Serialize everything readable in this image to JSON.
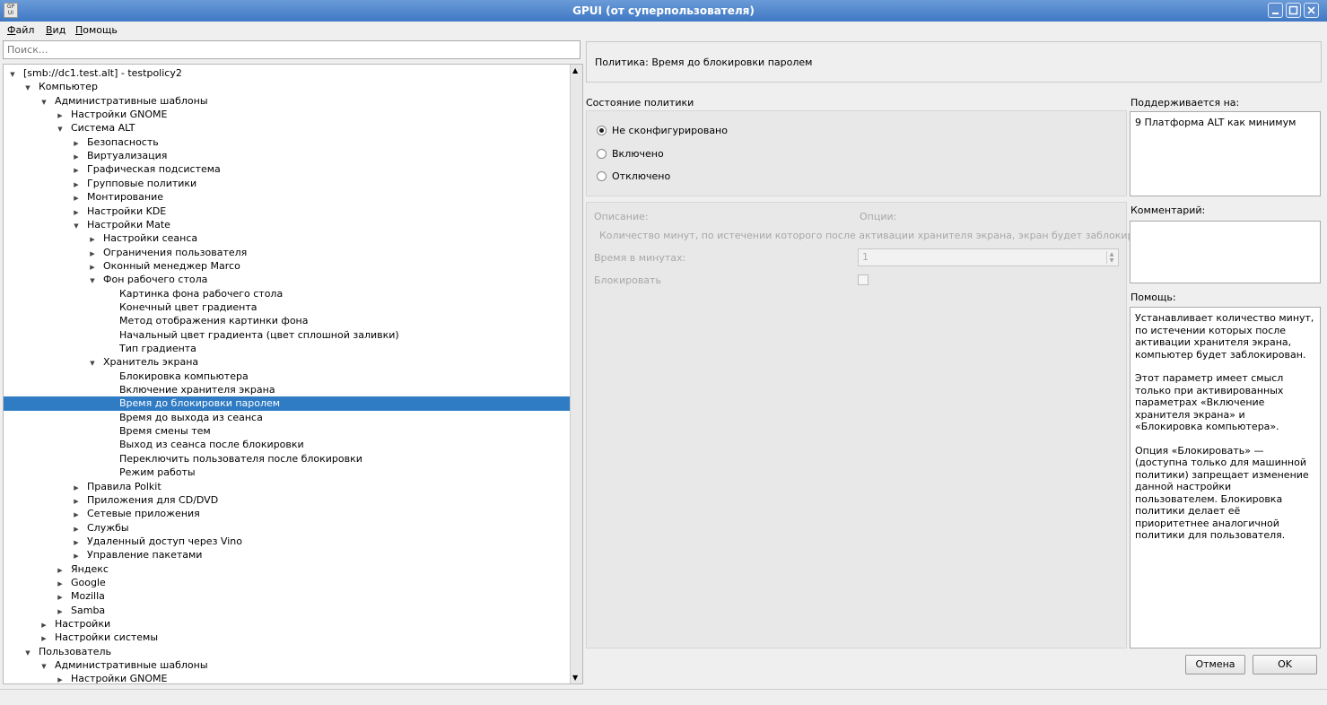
{
  "window": {
    "title": "GPUI (от суперпользователя)",
    "icon_text": "GP UI",
    "controls": [
      "minimize-icon",
      "maximize-icon",
      "close-icon"
    ]
  },
  "menu": [
    "Файл",
    "Вид",
    "Помощь"
  ],
  "search": {
    "placeholder": "Поиск..."
  },
  "tree": [
    {
      "label": "[smb://dc1.test.alt] - testpolicy2",
      "level": 0,
      "arrow": "down"
    },
    {
      "label": "Компьютер",
      "level": 1,
      "arrow": "down"
    },
    {
      "label": "Административные шаблоны",
      "level": 2,
      "arrow": "down"
    },
    {
      "label": "Настройки GNOME",
      "level": 3,
      "arrow": "right"
    },
    {
      "label": "Система ALT",
      "level": 3,
      "arrow": "down"
    },
    {
      "label": "Безопасность",
      "level": 4,
      "arrow": "right"
    },
    {
      "label": "Виртуализация",
      "level": 4,
      "arrow": "right"
    },
    {
      "label": "Графическая подсистема",
      "level": 4,
      "arrow": "right"
    },
    {
      "label": "Групповые политики",
      "level": 4,
      "arrow": "right"
    },
    {
      "label": "Монтирование",
      "level": 4,
      "arrow": "right"
    },
    {
      "label": "Настройки KDE",
      "level": 4,
      "arrow": "right"
    },
    {
      "label": "Настройки Mate",
      "level": 4,
      "arrow": "down"
    },
    {
      "label": "Настройки сеанса",
      "level": 5,
      "arrow": "right"
    },
    {
      "label": "Ограничения пользователя",
      "level": 5,
      "arrow": "right"
    },
    {
      "label": "Оконный менеджер Marco",
      "level": 5,
      "arrow": "right"
    },
    {
      "label": "Фон рабочего стола",
      "level": 5,
      "arrow": "down"
    },
    {
      "label": "Картинка фона рабочего стола",
      "level": 6,
      "arrow": ""
    },
    {
      "label": "Конечный цвет градиента",
      "level": 6,
      "arrow": ""
    },
    {
      "label": "Метод отображения картинки фона",
      "level": 6,
      "arrow": ""
    },
    {
      "label": "Начальный цвет градиента (цвет сплошной заливки)",
      "level": 6,
      "arrow": ""
    },
    {
      "label": "Тип градиента",
      "level": 6,
      "arrow": ""
    },
    {
      "label": "Хранитель экрана",
      "level": 5,
      "arrow": "down"
    },
    {
      "label": "Блокировка компьютера",
      "level": 6,
      "arrow": ""
    },
    {
      "label": "Включение хранителя экрана",
      "level": 6,
      "arrow": ""
    },
    {
      "label": "Время до блокировки паролем",
      "level": 6,
      "arrow": "",
      "selected": true
    },
    {
      "label": "Время до выхода из сеанса",
      "level": 6,
      "arrow": ""
    },
    {
      "label": "Время смены тем",
      "level": 6,
      "arrow": ""
    },
    {
      "label": "Выход из сеанса после блокировки",
      "level": 6,
      "arrow": ""
    },
    {
      "label": "Переключить пользователя после блокировки",
      "level": 6,
      "arrow": ""
    },
    {
      "label": "Режим работы",
      "level": 6,
      "arrow": ""
    },
    {
      "label": "Правила Polkit",
      "level": 4,
      "arrow": "right"
    },
    {
      "label": "Приложения для CD/DVD",
      "level": 4,
      "arrow": "right"
    },
    {
      "label": "Сетевые приложения",
      "level": 4,
      "arrow": "right"
    },
    {
      "label": "Службы",
      "level": 4,
      "arrow": "right"
    },
    {
      "label": "Удаленный доступ через Vino",
      "level": 4,
      "arrow": "right"
    },
    {
      "label": "Управление пакетами",
      "level": 4,
      "arrow": "right"
    },
    {
      "label": "Яндекс",
      "level": 3,
      "arrow": "right"
    },
    {
      "label": "Google",
      "level": 3,
      "arrow": "right"
    },
    {
      "label": "Mozilla",
      "level": 3,
      "arrow": "right"
    },
    {
      "label": "Samba",
      "level": 3,
      "arrow": "right"
    },
    {
      "label": "Настройки",
      "level": 2,
      "arrow": "right"
    },
    {
      "label": "Настройки системы",
      "level": 2,
      "arrow": "right"
    },
    {
      "label": "Пользователь",
      "level": 1,
      "arrow": "down"
    },
    {
      "label": "Административные шаблоны",
      "level": 2,
      "arrow": "down"
    },
    {
      "label": "Настройки GNOME",
      "level": 3,
      "arrow": "right"
    }
  ],
  "policy": {
    "title": "Политика: Время до блокировки паролем",
    "state_label": "Состояние политики",
    "states": [
      {
        "label": "Не сконфигурировано",
        "checked": true
      },
      {
        "label": "Включено",
        "checked": false
      },
      {
        "label": "Отключено",
        "checked": false
      }
    ],
    "description_label": "Описание:",
    "options_label": "Опции:",
    "option_description": "Количество минут, по истечении которого после активации хранителя экрана, экран будет заблокирован",
    "minutes_label": "Время в минутах:",
    "minutes_value": "1",
    "lock_label": "Блокировать"
  },
  "supported": {
    "label": "Поддерживается на:",
    "value": "9 Платформа ALT как минимум"
  },
  "comment": {
    "label": "Комментарий:",
    "value": ""
  },
  "help": {
    "label": "Помощь:",
    "paragraphs": [
      "Устанавливает количество минут, по истечении которых после активации хранителя экрана, компьютер будет заблокирован.",
      "Этот параметр имеет смысл только при активированных параметрах «Включение хранителя экрана» и «Блокировка компьютера».",
      "Опция «Блокировать» — (доступна только для машинной политики) запрещает изменение данной настройки пользователем. Блокировка политики делает её приоритетнее аналогичной политики для пользователя."
    ]
  },
  "buttons": {
    "cancel": "Отмена",
    "ok": "OK"
  },
  "colors": {
    "selection": "#2f7bc4",
    "titlebar": "#4a82cc"
  }
}
